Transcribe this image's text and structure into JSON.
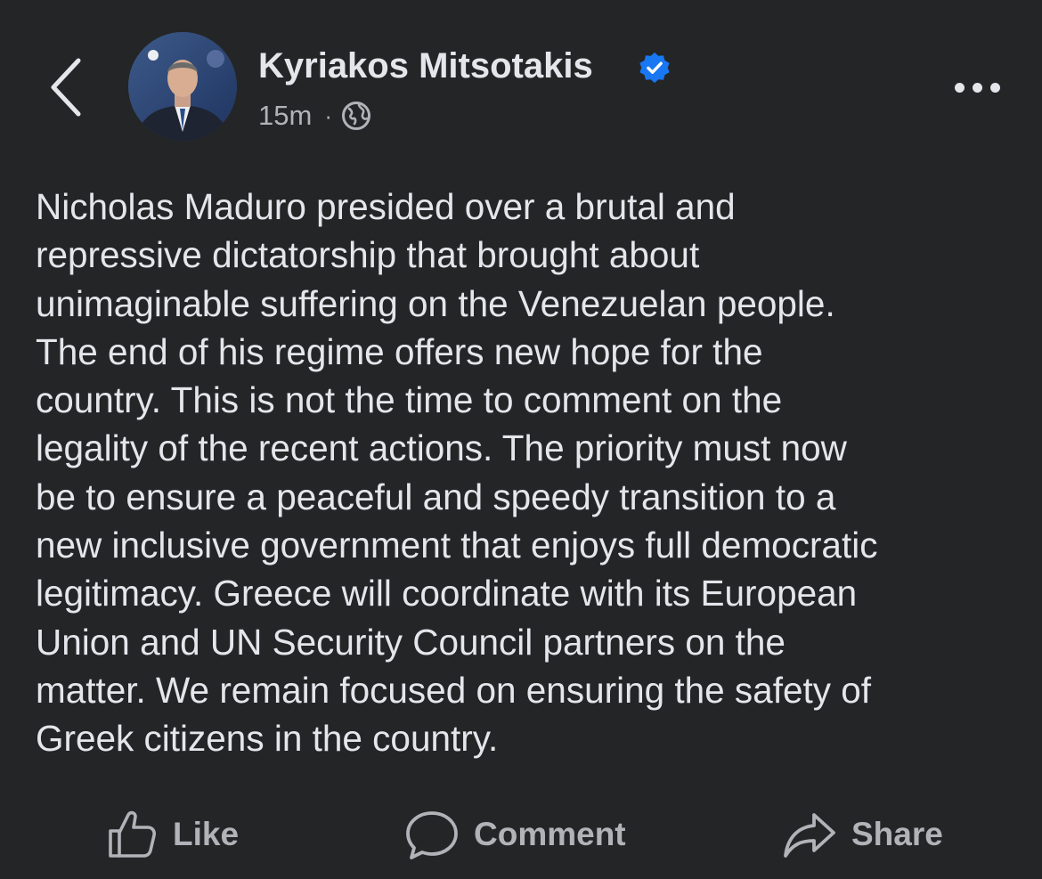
{
  "header": {
    "back_icon": "chevron-left-icon",
    "author_name": "Kyriakos Mitsotakis",
    "verified_icon": "verified-badge-icon",
    "time": "15m",
    "separator": "·",
    "audience_icon": "globe-icon",
    "more_icon": "more-options-icon"
  },
  "post": {
    "text": "Nicholas Maduro presided over a brutal and\nrepressive dictatorship that brought about\nunimaginable suffering on the Venezuelan people.\nThe end of his regime offers new hope for the\ncountry. This is not the time to comment on the\nlegality of the recent actions. The priority must now\nbe to ensure a peaceful and speedy transition to a\nnew inclusive government that enjoys full democratic\nlegitimacy. Greece will coordinate with its European\nUnion and UN Security Council partners on the\nmatter. We remain focused on ensuring the safety of\nGreek citizens in the country."
  },
  "actions": {
    "like_label": "Like",
    "comment_label": "Comment",
    "share_label": "Share"
  },
  "colors": {
    "background": "#242526",
    "primary_text": "#e4e6eb",
    "secondary_text": "#b0b3b8",
    "verified_blue": "#1877f2"
  }
}
